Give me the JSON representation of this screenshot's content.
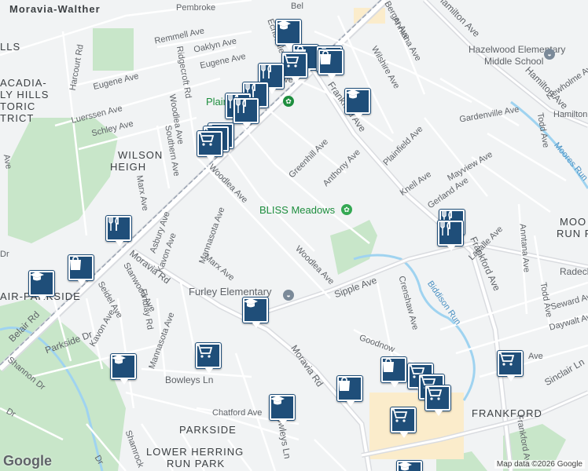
{
  "map": {
    "attribution": "Map data ©2026 Google",
    "logo": "Google",
    "colors": {
      "land": "#f1f3f4",
      "road": "#ffffff",
      "major_road": "#dadce0",
      "park": "#c8e6c9",
      "water": "#9fd3f0",
      "industrial": "#fbeccb",
      "railway": "#9aa4b2",
      "pin": "#1f4e79"
    }
  },
  "streets": [
    "Moravia-Walther",
    "Pembroke",
    "Remmell Ave",
    "Oaklyn Ave",
    "Eugene Ave",
    "Harcourt Rd",
    "Eugene Ave",
    "Luerssen Ave",
    "Schley Ave",
    "Ridgecroft Rd",
    "Woodlea Ave",
    "Southern Ave",
    "Marx Ave",
    "Asbury Ave",
    "Kavon Ave",
    "Mannasota Ave",
    "Marx Ave",
    "Stanwood Ave",
    "Seidel Ave",
    "Moravia Rd",
    "Belair Rd",
    "Parkside Dr",
    "Kavon Ave",
    "Findlay Rd",
    "Mannasota Ave",
    "Bowleys Ln",
    "Shannon Dr",
    "Chatford Ave",
    "Bowleys Ln",
    "Moravia Rd",
    "Woodlea Ave",
    "Greenhill Ave",
    "Anthony Ave",
    "Frankford Ave",
    "Wilshire Ave",
    "Anntana Ave",
    "Berger Ave",
    "Hamilton Ave",
    "Gardenville Ave",
    "Plainfield Ave",
    "Knell Ave",
    "Mayview Ave",
    "Gerland Ave",
    "Lasalle Ave",
    "Frankford Ave",
    "Anntana Ave",
    "Todd Ave",
    "Radecke",
    "Seward Ave",
    "Daywalt Ave",
    "Todd Ave",
    "Sipple Ave",
    "Crenshaw Ave",
    "Goodnow",
    "Sinclair Ln",
    "Newholme Ave",
    "Moores Run",
    "Biddison Run",
    "Hamilton Ave",
    "Echodale",
    "Ave",
    "Bel",
    "Shamrock",
    "Woodlea Ave",
    "Dr",
    "Hamilton Ave",
    "Ave",
    "Ave",
    "Frankford Ave",
    "Dr",
    "Dr"
  ],
  "areas": [
    "ACADIA-",
    "LY HILLS",
    "TORIC",
    "TRICT",
    "WILSON",
    "HEIGH",
    "PARKSIDE",
    "LOWER HERRING",
    "RUN PARK",
    "FRANKFORD",
    "AIR-PARKSIDE",
    "MOO",
    "RUN P",
    "LLS"
  ],
  "places": {
    "bliss": "BLISS Meadows",
    "plainfield": "Plainfield",
    "furley": "Furley Elementary",
    "hazelwood1": "Hazelwood Elementary",
    "hazelwood2": "Middle School"
  },
  "pins": [
    {
      "type": "school-icon"
    },
    {
      "type": "shopping-bag-icon"
    },
    {
      "type": "shopping-bag-icon"
    },
    {
      "type": "shopping-cart-icon"
    },
    {
      "type": "restaurant-icon"
    },
    {
      "type": "restaurant-icon"
    },
    {
      "type": "shopping-bag-icon"
    },
    {
      "type": "school-icon"
    },
    {
      "type": "restaurant-icon"
    },
    {
      "type": "restaurant-icon"
    },
    {
      "type": "shopping-cart-icon"
    },
    {
      "type": "shopping-cart-icon"
    },
    {
      "type": "shopping-cart-icon"
    },
    {
      "type": "restaurant-icon"
    },
    {
      "type": "shopping-bag-icon"
    },
    {
      "type": "school-icon"
    },
    {
      "type": "restaurant-icon"
    },
    {
      "type": "restaurant-icon"
    },
    {
      "type": "school-icon"
    },
    {
      "type": "shopping-cart-icon"
    },
    {
      "type": "school-icon"
    },
    {
      "type": "shopping-bag-icon"
    },
    {
      "type": "school-icon"
    },
    {
      "type": "shopping-cart-icon"
    },
    {
      "type": "shopping-bag-icon"
    },
    {
      "type": "shopping-cart-icon"
    },
    {
      "type": "shopping-cart-icon"
    },
    {
      "type": "shopping-cart-icon"
    },
    {
      "type": "shopping-cart-icon"
    },
    {
      "type": "school-icon"
    }
  ]
}
